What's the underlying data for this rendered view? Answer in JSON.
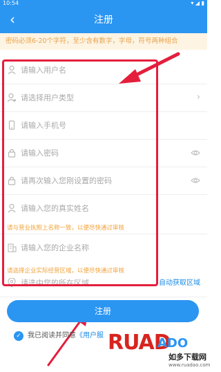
{
  "status_bar": {
    "time": "10:54",
    "indicators": "▾ ◢ ▮"
  },
  "header": {
    "back_icon": "‹",
    "title": "注册"
  },
  "notice": "密码必须6-20个字符，至少含有数字，字母，符号两种组合",
  "fields": [
    {
      "icon": "user-icon",
      "placeholder": "请输入用户名"
    },
    {
      "icon": "user-type-icon",
      "placeholder": "请选择用户类型",
      "tail": "›"
    },
    {
      "icon": "phone-icon",
      "placeholder": "请输入手机号"
    },
    {
      "icon": "lock-icon",
      "placeholder": "请输入密码",
      "tail": "◉"
    },
    {
      "icon": "lock-icon",
      "placeholder": "请再次输入您刚设置的密码",
      "tail": "◉"
    },
    {
      "icon": "user-icon",
      "placeholder": "请输入您的真实姓名"
    },
    {
      "icon": "building-icon",
      "placeholder": "请输入您的企业名称"
    },
    {
      "icon": "location-icon",
      "placeholder": "请选中您的所在区域",
      "action": "自动获取区域"
    }
  ],
  "hints": {
    "real_name": "请与营业执照上名称一致，以便尽快通过审核",
    "company": "请选择企业实际经营区域，以便尽快通过审核"
  },
  "submit_label": "注册",
  "agree": {
    "text": "我已阅读并同意",
    "link": "《用户服"
  },
  "watermark": {
    "ruad": "RUAD",
    "dado": "ADO",
    "cn": "如多下载网",
    "url": "www.ruadao.com"
  },
  "colors": {
    "brand": "#2b95f2",
    "hint": "#f2a33a",
    "annotation": "#e41e3c"
  }
}
